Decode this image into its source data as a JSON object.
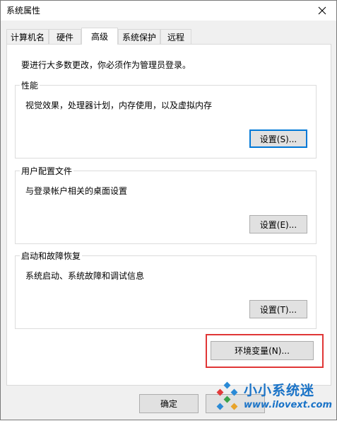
{
  "window": {
    "title": "系统属性"
  },
  "tabs": [
    {
      "label": "计算机名"
    },
    {
      "label": "硬件"
    },
    {
      "label": "高级"
    },
    {
      "label": "系统保护"
    },
    {
      "label": "远程"
    }
  ],
  "notice": "要进行大多数更改，你必须作为管理员登录。",
  "performance": {
    "title": "性能",
    "desc": "视觉效果，处理器计划，内存使用，以及虚拟内存",
    "button": "设置(S)..."
  },
  "user_profiles": {
    "title": "用户配置文件",
    "desc": "与登录帐户相关的桌面设置",
    "button": "设置(E)..."
  },
  "startup_recovery": {
    "title": "启动和故障恢复",
    "desc": "系统启动、系统故障和调试信息",
    "button": "设置(T)..."
  },
  "env_button": "环境变量(N)...",
  "footer": {
    "ok": "确定"
  },
  "watermark": {
    "brand": "小小系统迷",
    "url": "www.ilovext.com"
  },
  "colors": {
    "highlight_box": "#e03636",
    "watermark": "#1a73c7",
    "focus": "#0078d7"
  }
}
